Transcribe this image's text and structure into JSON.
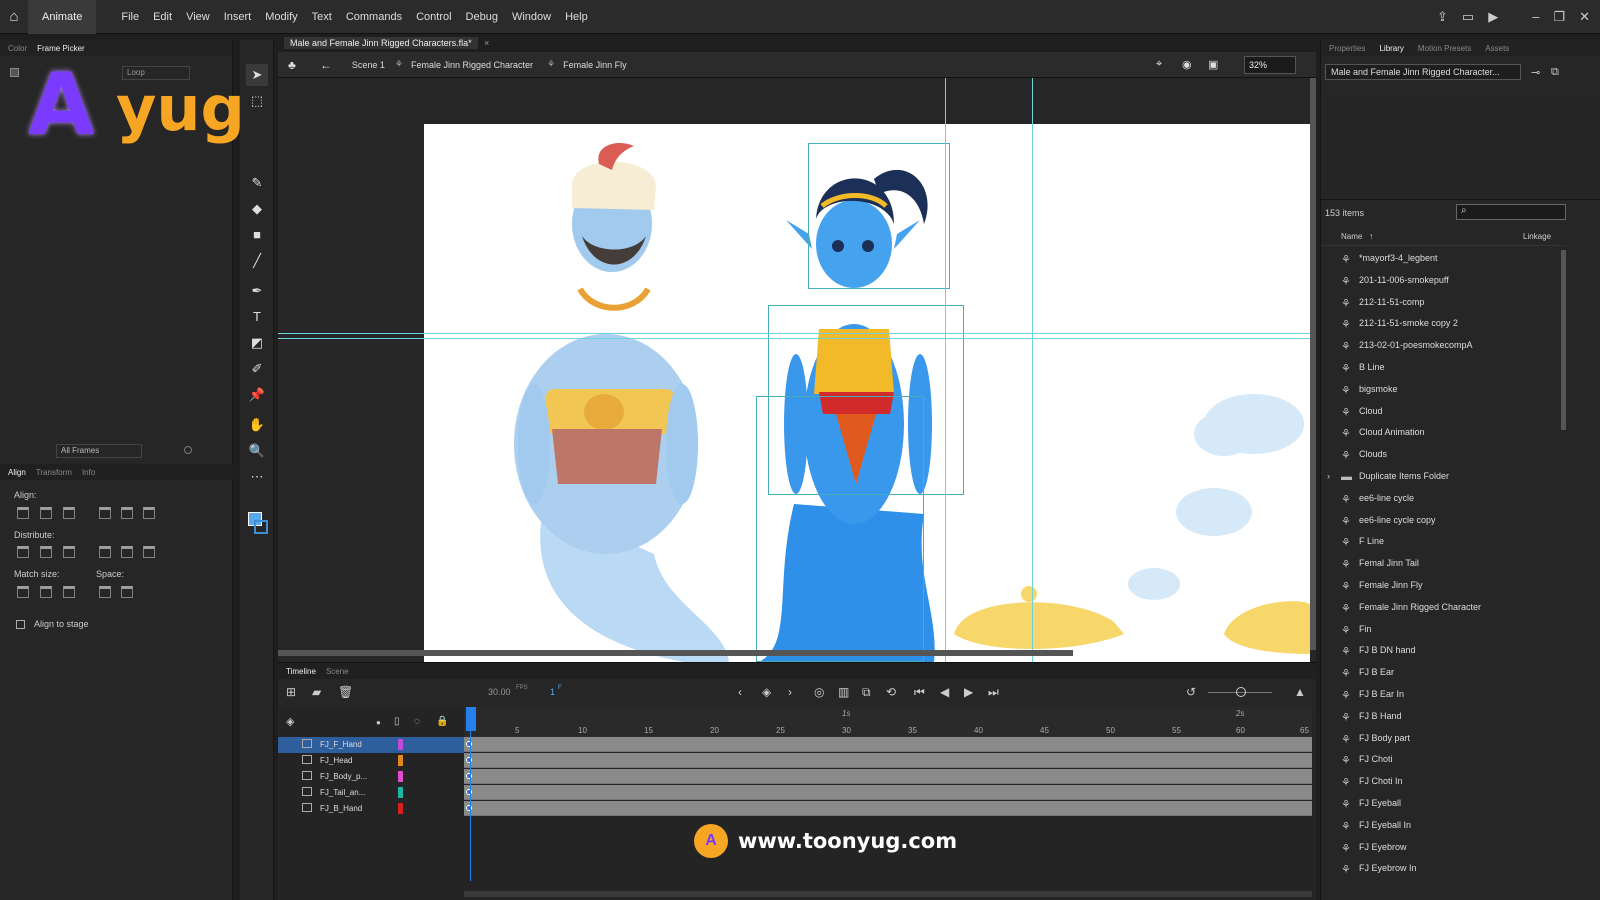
{
  "menubar": {
    "app_name": "Animate",
    "items": [
      "File",
      "Edit",
      "View",
      "Insert",
      "Modify",
      "Text",
      "Commands",
      "Control",
      "Debug",
      "Window",
      "Help"
    ]
  },
  "left_panel": {
    "tabs": [
      "Color",
      "Frame Picker"
    ],
    "loop_label": "Loop",
    "frames_select": "All Frames",
    "bottom_tabs": [
      "Align",
      "Transform",
      "Info"
    ],
    "align": {
      "align_label": "Align:",
      "distribute_label": "Distribute:",
      "match_size_label": "Match size:",
      "space_label": "Space:",
      "align_to_stage_label": "Align to stage"
    }
  },
  "document": {
    "tab_title": "Male and Female Jinn Rigged Characters.fla*",
    "breadcrumb": [
      "Scene 1",
      "Female Jinn Rigged Character",
      "Female Jinn Fly"
    ],
    "zoom": "32%"
  },
  "timeline": {
    "tabs": [
      "Timeline",
      "Scene"
    ],
    "fps": "30.00",
    "fps_unit": "FPS",
    "current_frame": "1",
    "frame_unit": "F",
    "ruler": [
      "5",
      "10",
      "15",
      "20",
      "25",
      "30",
      "35",
      "40",
      "45",
      "50",
      "55",
      "60",
      "65"
    ],
    "ruler_seconds": [
      "1s",
      "2s"
    ],
    "layers": [
      {
        "name": "FJ_F_Hand",
        "color": "#c04bd8"
      },
      {
        "name": "FJ_Head",
        "color": "#e08a1e"
      },
      {
        "name": "FJ_Body_p...",
        "color": "#e04bd0"
      },
      {
        "name": "FJ_Tail_an...",
        "color": "#1fb5a5"
      },
      {
        "name": "FJ_B_Hand",
        "color": "#d81e1e"
      }
    ]
  },
  "library": {
    "tabs": [
      "Properties",
      "Library",
      "Motion Presets",
      "Assets"
    ],
    "selected_file": "Male and Female Jinn Rigged Character...",
    "item_count": "153 items",
    "col_name": "Name",
    "col_linkage": "Linkage",
    "items": [
      "*mayorf3-4_legbent",
      "201-11-006-smokepuff",
      "212-11-51-comp",
      "212-11-51-smoke copy 2",
      "213-02-01-poesmokecompA",
      "B Line",
      "bigsmoke",
      "Cloud",
      "Cloud Animation",
      "Clouds",
      "Duplicate Items Folder",
      "ee6-line cycle",
      "ee6-line cycle copy",
      "F Line",
      "Femal Jinn Tail",
      "Female Jinn Fly",
      "Female Jinn Rigged Character",
      "Fin",
      "FJ B DN hand",
      "FJ B Ear",
      "FJ B Ear In",
      "FJ B Hand",
      "FJ Body part",
      "FJ Choti",
      "FJ Choti In",
      "FJ Eyeball",
      "FJ Eyeball In",
      "FJ Eyebrow",
      "FJ Eyebrow In"
    ]
  },
  "watermark": {
    "logo_a": "A",
    "logo_text": "yug",
    "website": "www.toonyug.com"
  },
  "colors": {
    "accent": "#2680eb",
    "guide": "#6fd3dd",
    "genie_male": "#9cc8ee",
    "genie_female": "#2e90e8",
    "gold": "#f2b929"
  }
}
